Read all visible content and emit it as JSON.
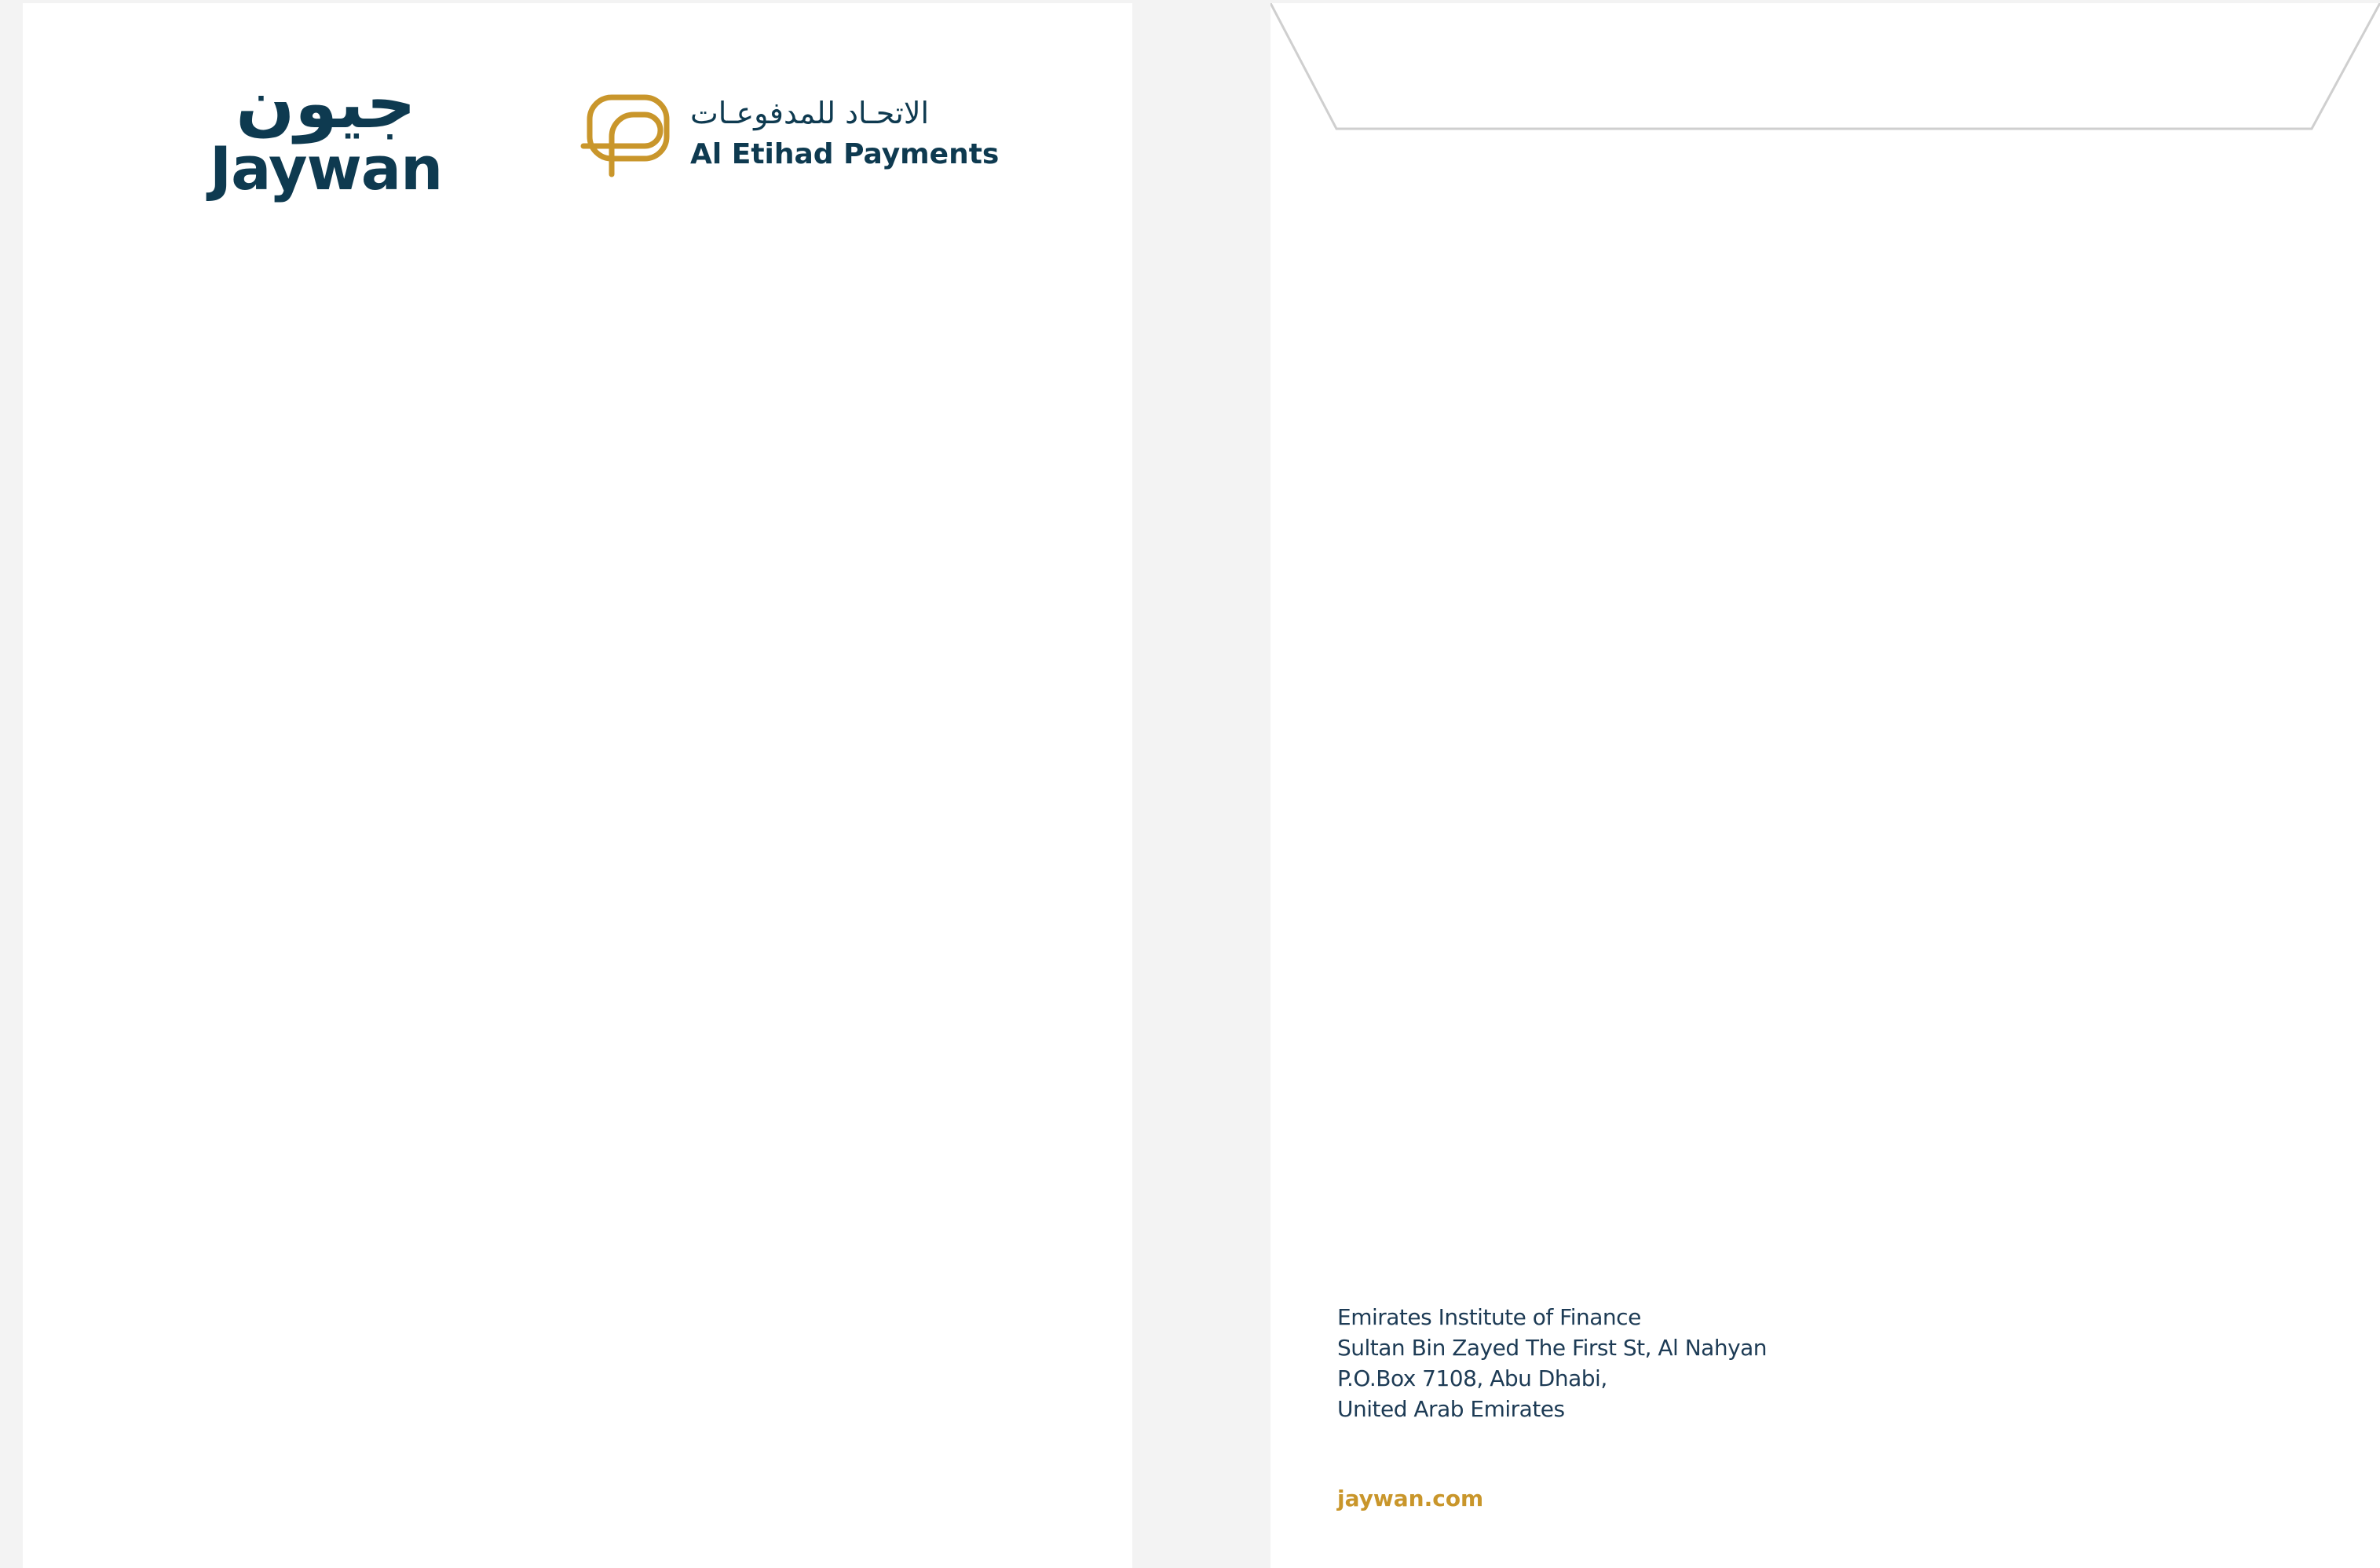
{
  "colors": {
    "brand_navy": "#0e3a50",
    "brand_gold": "#c9962b",
    "address_text": "#1d3b55",
    "background": "#f3f3f3",
    "paper": "#ffffff"
  },
  "letterhead": {
    "jaywan_logo": {
      "arabic": "جيون",
      "english": "Jaywan"
    },
    "aep_logo": {
      "icon": "aep-monogram-icon",
      "arabic": "الاتحـاد للمدفوعـات",
      "english": "Al Etihad Payments"
    }
  },
  "envelope": {
    "address_lines": [
      "Emirates Institute of Finance",
      "Sultan Bin Zayed The First St, Al Nahyan",
      "P.O.Box 7108, Abu Dhabi,",
      "United Arab Emirates"
    ],
    "website": "jaywan.com"
  }
}
